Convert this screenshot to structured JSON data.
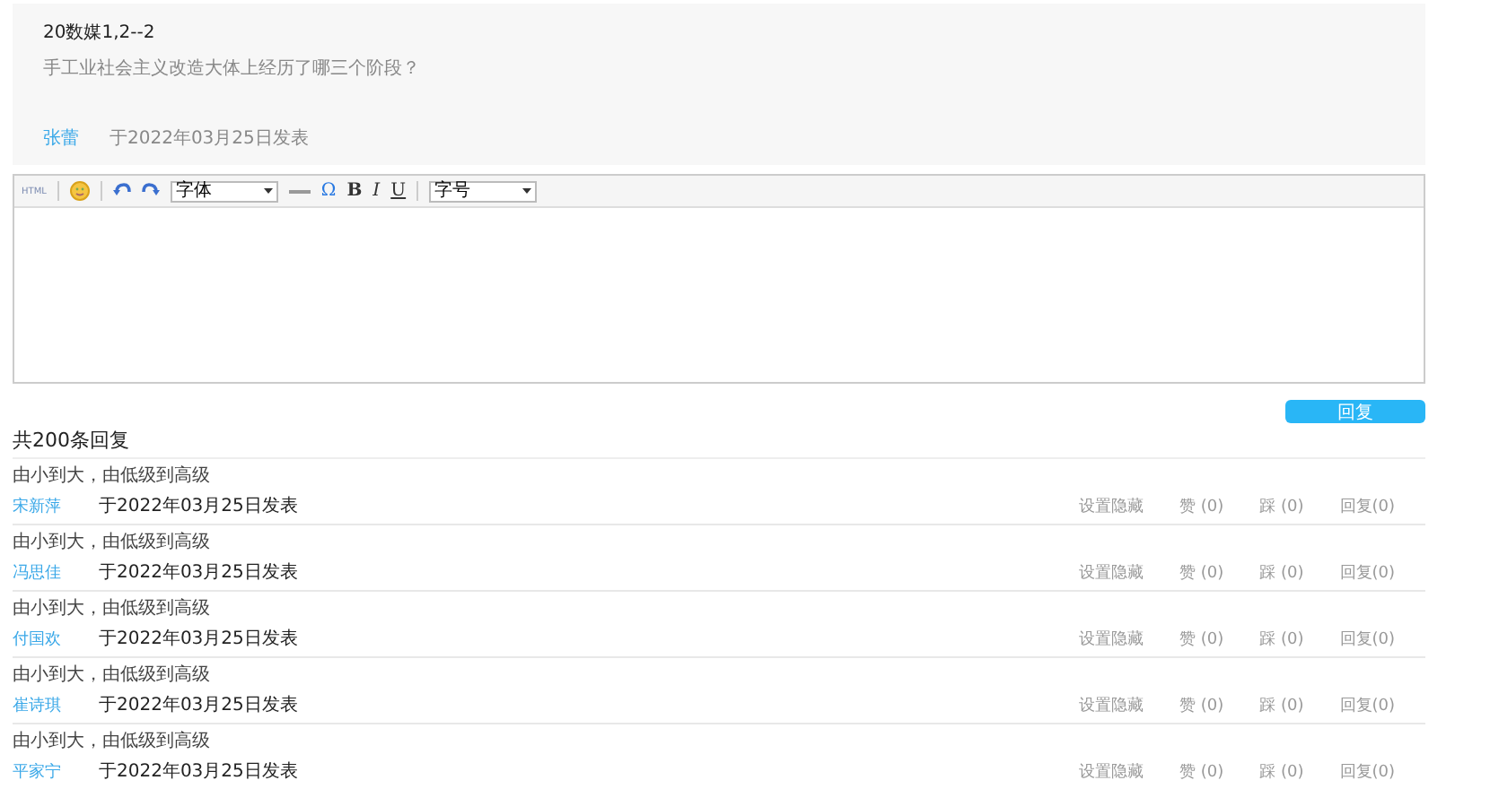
{
  "post": {
    "title": "20数媒1,2--2",
    "question": "手工业社会主义改造大体上经历了哪三个阶段？",
    "author": "张蕾",
    "date": "于2022年03月25日发表"
  },
  "editor": {
    "toolbar": [
      {
        "kind": "text",
        "label": "HTML"
      },
      {
        "kind": "sep"
      },
      {
        "kind": "smile"
      },
      {
        "kind": "sep"
      },
      {
        "kind": "undo"
      },
      {
        "kind": "redo"
      },
      {
        "kind": "select",
        "label": "字体"
      },
      {
        "kind": "hr"
      },
      {
        "kind": "omega",
        "label": "Ω"
      },
      {
        "kind": "bold",
        "label": "B"
      },
      {
        "kind": "italic",
        "label": "I"
      },
      {
        "kind": "underline",
        "label": "U"
      },
      {
        "kind": "sep"
      },
      {
        "kind": "select",
        "label": "字号"
      }
    ]
  },
  "reply_button": "回复",
  "count": "共200条回复",
  "replies": [
    {
      "text": "由小到大，由低级到高级",
      "author": "宋新萍",
      "date": "于2022年03月25日发表",
      "actions": [
        "设置隐藏",
        "赞 (0)",
        "踩 (0)",
        "回复(0)"
      ]
    },
    {
      "text": "由小到大，由低级到高级",
      "author": "冯思佳",
      "date": "于2022年03月25日发表",
      "actions": [
        "设置隐藏",
        "赞 (0)",
        "踩 (0)",
        "回复(0)"
      ]
    },
    {
      "text": "由小到大，由低级到高级",
      "author": "付国欢",
      "date": "于2022年03月25日发表",
      "actions": [
        "设置隐藏",
        "赞 (0)",
        "踩 (0)",
        "回复(0)"
      ]
    },
    {
      "text": "由小到大，由低级到高级",
      "author": "崔诗琪",
      "date": "于2022年03月25日发表",
      "actions": [
        "设置隐藏",
        "赞 (0)",
        "踩 (0)",
        "回复(0)"
      ]
    },
    {
      "text": "由小到大，由低级到高级",
      "author": "平家宁",
      "date": "于2022年03月25日发表",
      "actions": [
        "设置隐藏",
        "赞 (0)",
        "踩 (0)",
        "回复(0)"
      ]
    }
  ]
}
